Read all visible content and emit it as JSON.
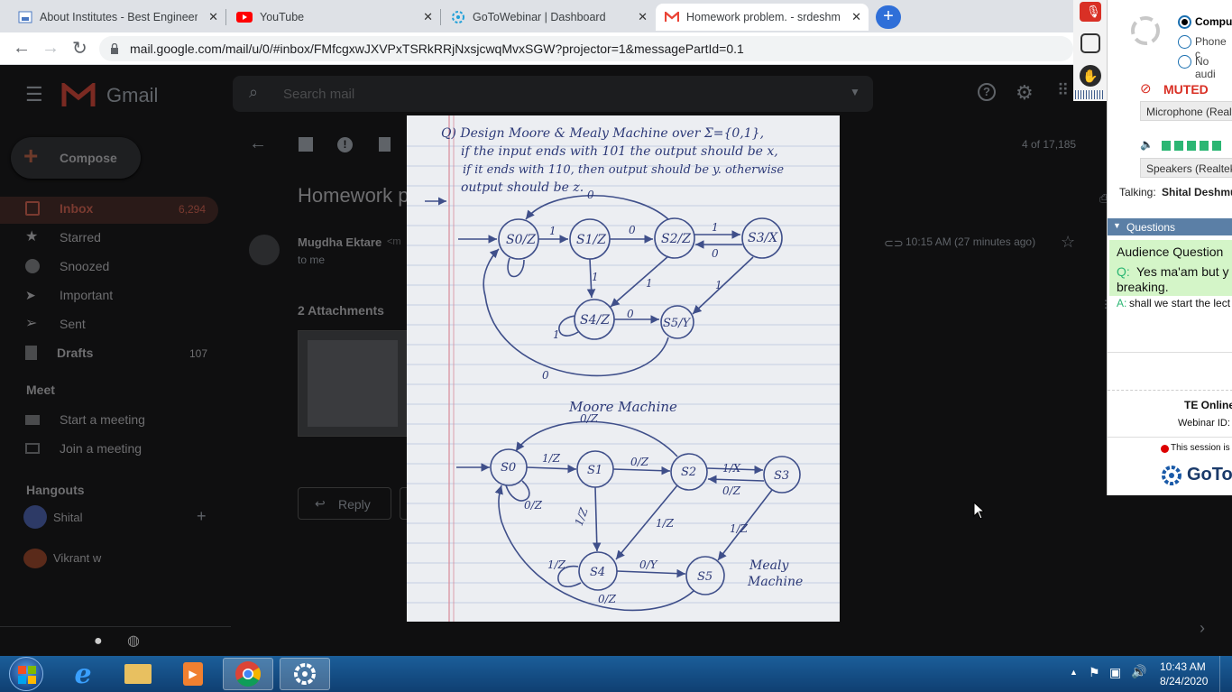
{
  "browser": {
    "tabs": [
      {
        "title": "About Institutes - Best Engineerin",
        "icon": "institute-favicon"
      },
      {
        "title": "YouTube",
        "icon": "youtube-favicon"
      },
      {
        "title": "GoToWebinar | Dashboard",
        "icon": "gotowebinar-favicon"
      },
      {
        "title": "Homework problem. - srdeshmuk",
        "icon": "gmail-favicon"
      }
    ],
    "url": "mail.google.com/mail/u/0/#inbox/FMfcgxwJXVPxTSRkRRjNxsjcwqMvxSGW?projector=1&messagePartId=0.1"
  },
  "gmail": {
    "logo_text": "Gmail",
    "search_placeholder": "Search mail",
    "compose": "Compose",
    "nav": [
      {
        "label": "Inbox",
        "count": "6,294"
      },
      {
        "label": "Starred",
        "count": ""
      },
      {
        "label": "Snoozed",
        "count": ""
      },
      {
        "label": "Important",
        "count": ""
      },
      {
        "label": "Sent",
        "count": ""
      },
      {
        "label": "Drafts",
        "count": "107"
      }
    ],
    "meet_header": "Meet",
    "meet_items": [
      "Start a meeting",
      "Join a meeting"
    ],
    "hangouts_header": "Hangouts",
    "hangouts_user": "Shital",
    "hangouts_contact": "Vikrant w",
    "pager": "4 of 17,185",
    "subject": "Homework p",
    "sender": "Mugdha Ektare",
    "sender_suffix": "<m",
    "to": "to me",
    "time": "10:15 AM (27 minutes ago)",
    "attachments": "2 Attachments",
    "reply": "Reply"
  },
  "photo_notes": {
    "question": [
      "Q) Design Moore & Mealy Machine over Σ={0,1},",
      "if the input ends with 101 the output should be x,",
      "if it ends with 110, then output should be y. otherwise",
      "output should be z."
    ],
    "moore_title": "Moore Machine",
    "mealy_title_1": "Mealy",
    "mealy_title_2": "Machine",
    "moore_states": [
      "S0/Z",
      "S1/Z",
      "S2/Z",
      "S3/X",
      "S4/Z",
      "S5/Y"
    ],
    "mealy_states": [
      "S0",
      "S1",
      "S2",
      "S3",
      "S4",
      "S5"
    ],
    "moore_labels": [
      "0",
      "1",
      "0",
      "1",
      "0",
      "1",
      "1",
      "1",
      "0",
      "1",
      "0"
    ],
    "mealy_labels": [
      "0/Z",
      "1/Z",
      "0/Z",
      "1/X",
      "0/Z",
      "0/Z",
      "1/Z",
      "1/Z",
      "1/Z",
      "1/Z",
      "0/Y",
      "0/Z"
    ]
  },
  "gotowebinar": {
    "audio_options": [
      "Comput",
      "Phone c",
      "No audi"
    ],
    "muted": "MUTED",
    "microphone": "Microphone (Realt",
    "speakers": "Speakers (Realtek",
    "talking_label": "Talking:",
    "talking_name": "Shital Deshmu",
    "questions_header": "Questions",
    "audience_title": "Audience Question",
    "q_prefix": "Q:",
    "question_text": "Yes ma'am but y",
    "question_text_2": "breaking.",
    "a_prefix": "A:",
    "answer_text": "shall we start the lect",
    "webinar_title": "TE Online",
    "webinar_id_label": "Webinar ID:",
    "session_text": "This session is",
    "brand": "GoToW"
  },
  "taskbar": {
    "time": "10:43 AM",
    "date": "8/24/2020"
  },
  "colors": {
    "gmail_red": "#ea4335",
    "gtw_green": "#2bb673",
    "muted_red": "#d93025",
    "questions_header": "#5b7fa6"
  }
}
